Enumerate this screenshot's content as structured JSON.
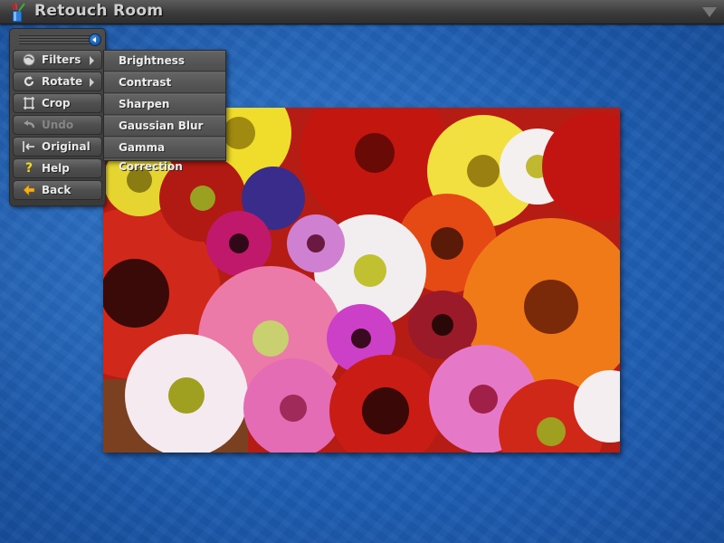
{
  "window": {
    "title": "Retouch Room",
    "app_icon": "paint-bucket-brushes-icon",
    "collapse_icon": "triangle-down-icon"
  },
  "toolbar": {
    "pin_icon": "circle-arrow-left-icon",
    "items": [
      {
        "label": "Filters",
        "icon": "filters-icon",
        "has_submenu": true,
        "enabled": true
      },
      {
        "label": "Rotate",
        "icon": "rotate-icon",
        "has_submenu": true,
        "enabled": true
      },
      {
        "label": "Crop",
        "icon": "crop-icon",
        "has_submenu": false,
        "enabled": true
      },
      {
        "label": "Undo",
        "icon": "undo-icon",
        "has_submenu": false,
        "enabled": false
      },
      {
        "label": "Original",
        "icon": "revert-original-icon",
        "has_submenu": false,
        "enabled": true
      },
      {
        "label": "Help",
        "icon": "question-icon",
        "has_submenu": false,
        "enabled": true
      },
      {
        "label": "Back",
        "icon": "back-arrow-icon",
        "has_submenu": false,
        "enabled": true
      }
    ]
  },
  "filters_submenu": {
    "items": [
      {
        "label": "Brightness"
      },
      {
        "label": "Contrast"
      },
      {
        "label": "Sharpen"
      },
      {
        "label": "Gaussian Blur"
      },
      {
        "label": "Gamma Correction"
      }
    ]
  },
  "image": {
    "description": "Photo of colorful gerbera daisies"
  }
}
